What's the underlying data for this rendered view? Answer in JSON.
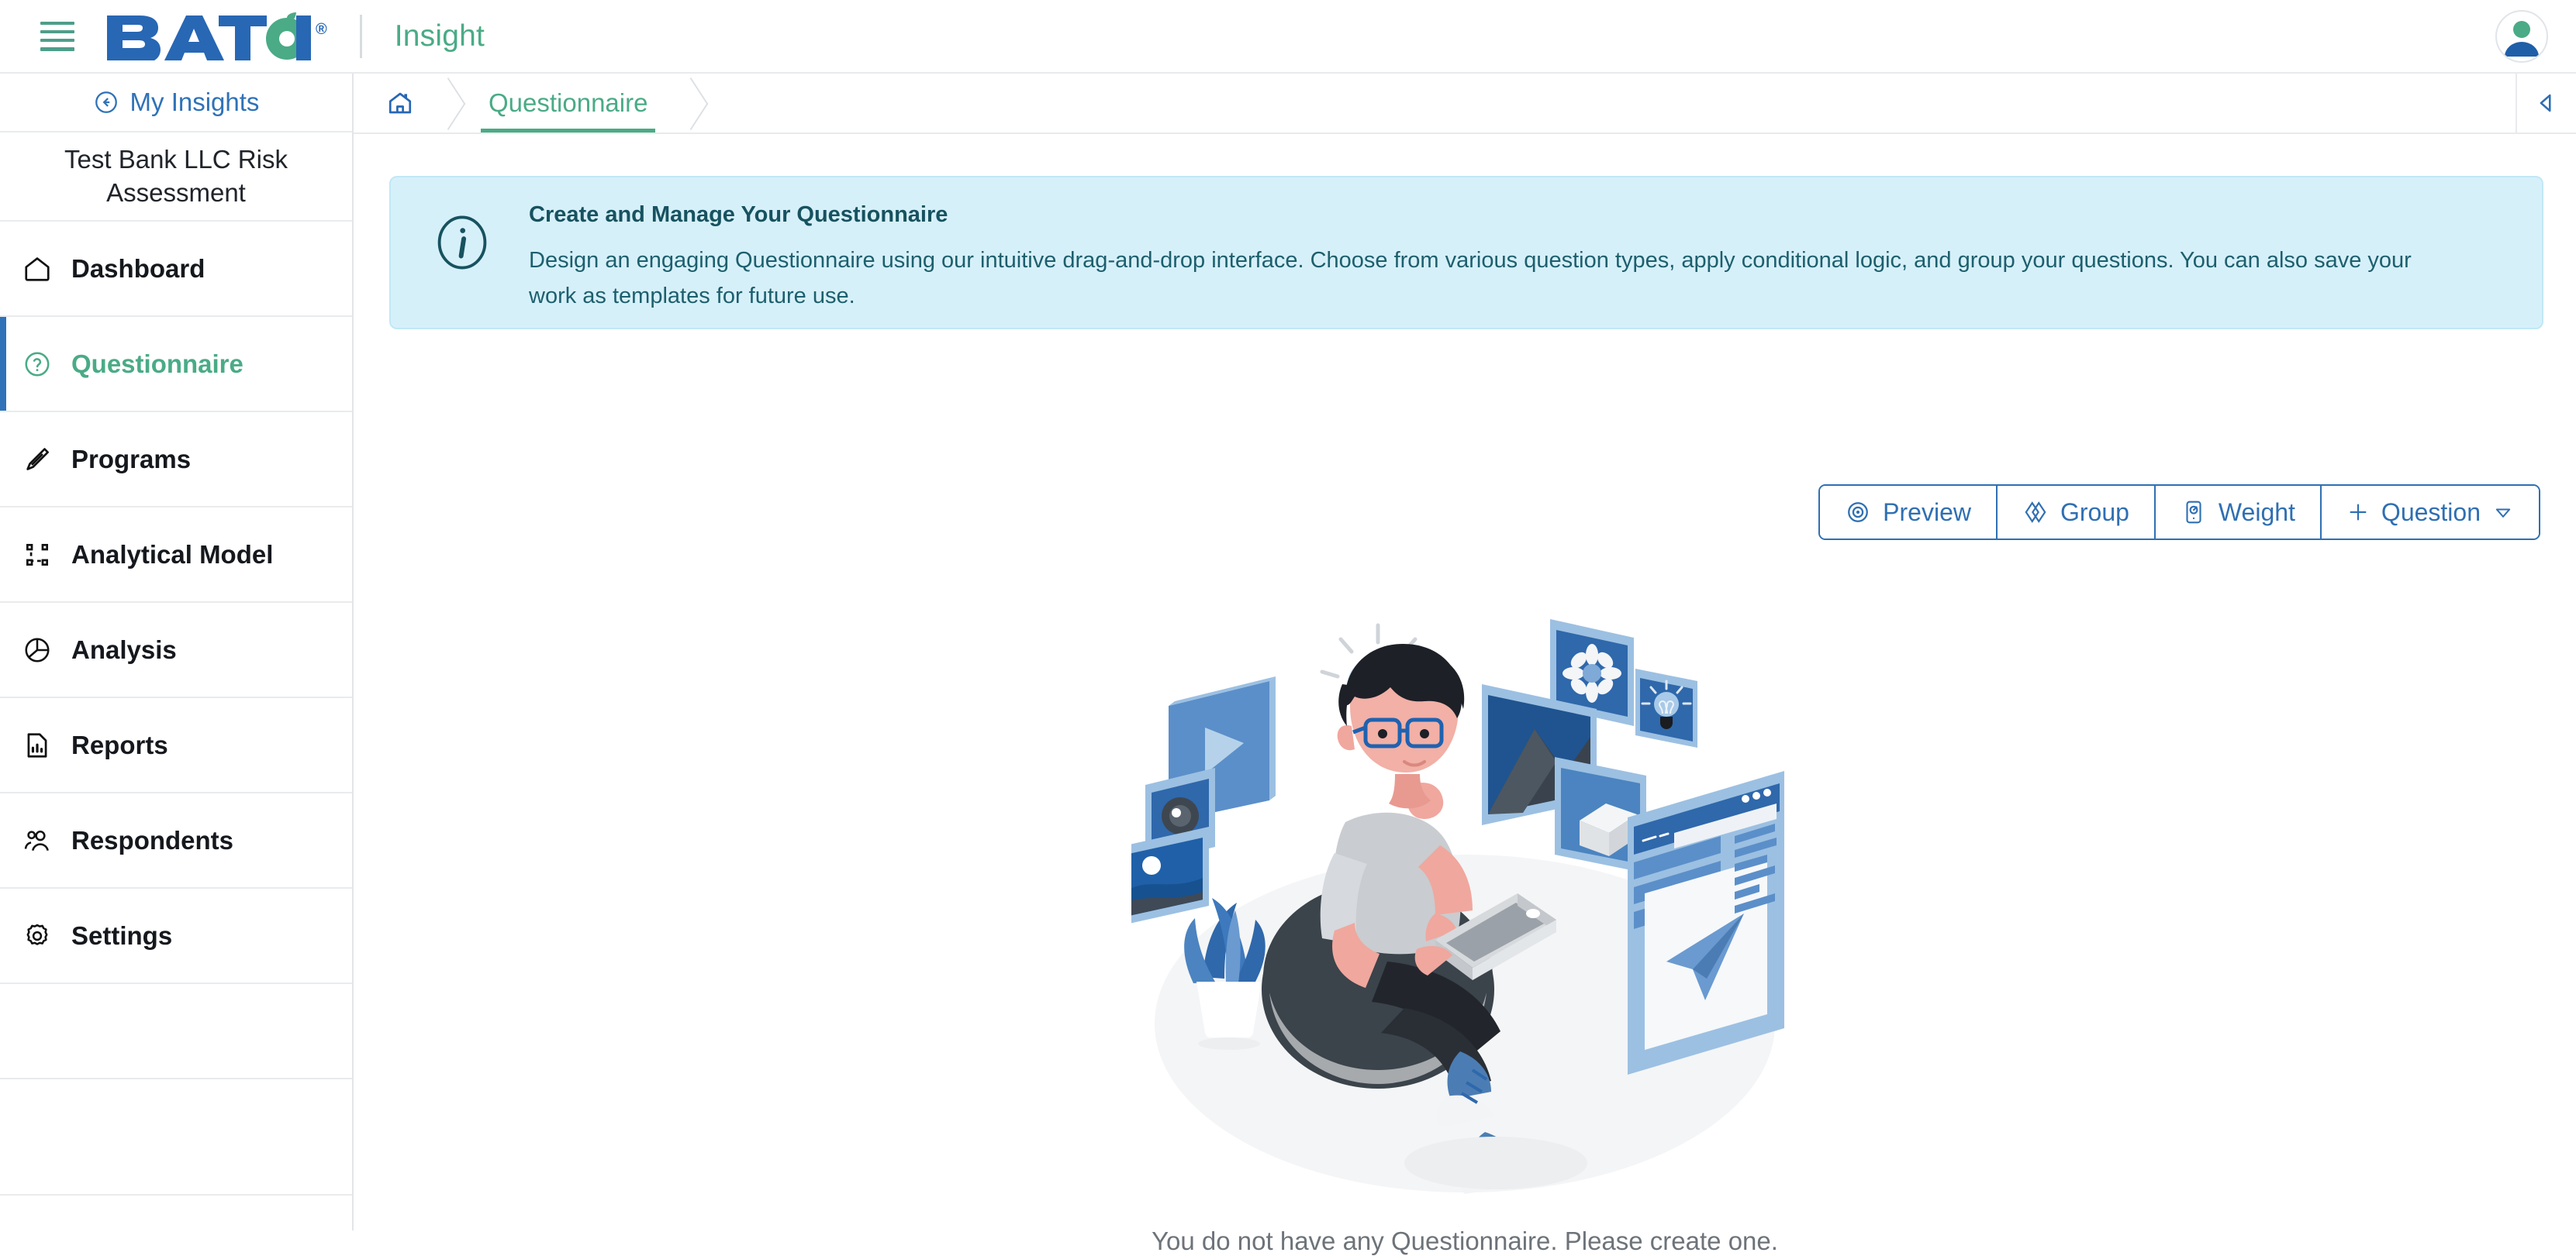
{
  "topbar": {
    "menu_icon": "hamburger-icon",
    "logo_text": "BATOI",
    "logo_registered": "®",
    "app_name": "Insight",
    "avatar_icon": "user-avatar-icon"
  },
  "sidebar": {
    "back_link": {
      "label": "My Insights",
      "icon": "arrow-left-circle-icon"
    },
    "context_name": "Test Bank LLC Risk Assessment",
    "items": [
      {
        "label": "Dashboard",
        "icon": "home-icon",
        "active": false
      },
      {
        "label": "Questionnaire",
        "icon": "question-circle-icon",
        "active": true
      },
      {
        "label": "Programs",
        "icon": "pen-nib-icon",
        "active": false
      },
      {
        "label": "Analytical Model",
        "icon": "crop-frame-icon",
        "active": false
      },
      {
        "label": "Analysis",
        "icon": "pie-chart-icon",
        "active": false
      },
      {
        "label": "Reports",
        "icon": "file-bar-chart-icon",
        "active": false
      },
      {
        "label": "Respondents",
        "icon": "users-icon",
        "active": false
      },
      {
        "label": "Settings",
        "icon": "gear-icon",
        "active": false
      }
    ]
  },
  "breadcrumb": {
    "home_icon": "home-icon",
    "current": "Questionnaire",
    "collapse_icon": "chevron-left-icon"
  },
  "banner": {
    "icon": "info-circle-icon",
    "title": "Create and Manage Your Questionnaire",
    "body": "Design an engaging Questionnaire using our intuitive drag-and-drop interface. Choose from various question types, apply conditional logic, and group your questions. You can also save your work as templates for future use."
  },
  "toolbar": {
    "buttons": [
      {
        "label": "Preview",
        "icon": "eye-icon"
      },
      {
        "label": "Group",
        "icon": "diamonds-icon"
      },
      {
        "label": "Weight",
        "icon": "weight-icon"
      },
      {
        "label": "Question",
        "icon": "plus-icon",
        "caret": "caret-down-icon"
      }
    ]
  },
  "empty_state": {
    "illustration": "person-on-beanbag-with-laptop-illustration",
    "message": "You do not have any Questionnaire. Please create one."
  },
  "colors": {
    "brand_blue": "#2767b4",
    "brand_green": "#4aab86",
    "link_blue": "#2f72b8",
    "banner_bg": "#d6f0fa",
    "banner_text": "#1d5f6d",
    "toolbar_blue": "#2f6fb3",
    "muted_text": "#6d7379"
  }
}
